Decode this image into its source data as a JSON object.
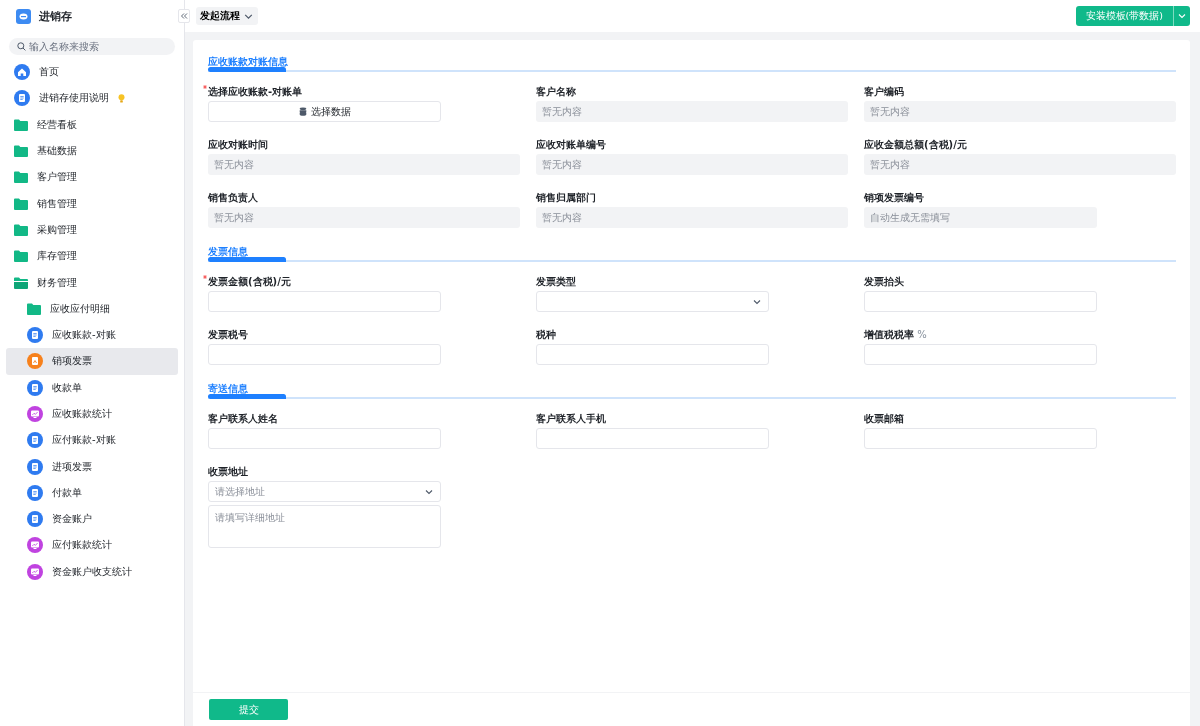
{
  "app": {
    "title": "进销存"
  },
  "search": {
    "placeholder": "输入名称来搜索"
  },
  "sidebar": {
    "items": [
      {
        "label": "首页",
        "kind": "home",
        "selected": false
      },
      {
        "label": "进销存使用说明",
        "kind": "doc",
        "selected": false,
        "tip": true
      },
      {
        "label": "经营看板",
        "kind": "folder",
        "selected": false
      },
      {
        "label": "基础数据",
        "kind": "folder",
        "selected": false
      },
      {
        "label": "客户管理",
        "kind": "folder",
        "selected": false
      },
      {
        "label": "销售管理",
        "kind": "folder",
        "selected": false
      },
      {
        "label": "采购管理",
        "kind": "folder",
        "selected": false
      },
      {
        "label": "库存管理",
        "kind": "folder",
        "selected": false
      },
      {
        "label": "财务管理",
        "kind": "folder",
        "selected": false,
        "expanded": true,
        "children": [
          {
            "label": "应收应付明细",
            "kind": "folder",
            "selected": false
          },
          {
            "label": "应收账款-对账",
            "kind": "doc",
            "selected": false
          },
          {
            "label": "销项发票",
            "kind": "invoice",
            "selected": true
          },
          {
            "label": "收款单",
            "kind": "doc",
            "selected": false
          },
          {
            "label": "应收账款统计",
            "kind": "chart",
            "selected": false
          },
          {
            "label": "应付账款-对账",
            "kind": "doc",
            "selected": false
          },
          {
            "label": "进项发票",
            "kind": "doc",
            "selected": false
          },
          {
            "label": "付款单",
            "kind": "doc",
            "selected": false
          },
          {
            "label": "资金账户",
            "kind": "doc",
            "selected": false
          },
          {
            "label": "应付账款统计",
            "kind": "chart",
            "selected": false
          },
          {
            "label": "资金账户收支统计",
            "kind": "chart",
            "selected": false
          }
        ]
      }
    ]
  },
  "toolbar": {
    "flow_menu": "发起流程",
    "install_button": "安装模板(带数据)"
  },
  "sections": [
    {
      "title": "应收账款对账信息",
      "fields": [
        {
          "label": "选择应收账款-对账单",
          "required": true,
          "kind": "button",
          "value": "选择数据"
        },
        {
          "label": "客户名称",
          "required": false,
          "kind": "readonly",
          "placeholder": "暂无内容"
        },
        {
          "label": "客户编码",
          "required": false,
          "kind": "readonly",
          "placeholder": "暂无内容"
        },
        {
          "label": "应收对账时间",
          "required": false,
          "kind": "readonly",
          "placeholder": "暂无内容"
        },
        {
          "label": "应收对账单编号",
          "required": false,
          "kind": "readonly",
          "placeholder": "暂无内容"
        },
        {
          "label": "应收金额总额(含税)/元",
          "required": false,
          "kind": "readonly",
          "placeholder": "暂无内容"
        },
        {
          "label": "销售负责人",
          "required": false,
          "kind": "readonly",
          "placeholder": "暂无内容"
        },
        {
          "label": "销售归属部门",
          "required": false,
          "kind": "readonly",
          "placeholder": "暂无内容"
        },
        {
          "label": "销项发票编号",
          "required": false,
          "kind": "auto",
          "placeholder": "自动生成无需填写"
        }
      ]
    },
    {
      "title": "发票信息",
      "fields": [
        {
          "label": "发票金额(含税)/元",
          "required": true,
          "kind": "input"
        },
        {
          "label": "发票类型",
          "required": false,
          "kind": "select"
        },
        {
          "label": "发票抬头",
          "required": false,
          "kind": "input"
        },
        {
          "label": "发票税号",
          "required": false,
          "kind": "input"
        },
        {
          "label": "税种",
          "required": false,
          "kind": "input"
        },
        {
          "label": "增值税税率",
          "unit": "%",
          "required": false,
          "kind": "input"
        }
      ]
    },
    {
      "title": "寄送信息",
      "fields": [
        {
          "label": "客户联系人姓名",
          "required": false,
          "kind": "input"
        },
        {
          "label": "客户联系人手机",
          "required": false,
          "kind": "input"
        },
        {
          "label": "收票邮箱",
          "required": false,
          "kind": "input"
        },
        {
          "label": "收票地址",
          "required": false,
          "kind": "address",
          "select_placeholder": "请选择地址",
          "placeholder": "请填写详细地址"
        }
      ]
    }
  ],
  "footer": {
    "submit": "提交"
  }
}
